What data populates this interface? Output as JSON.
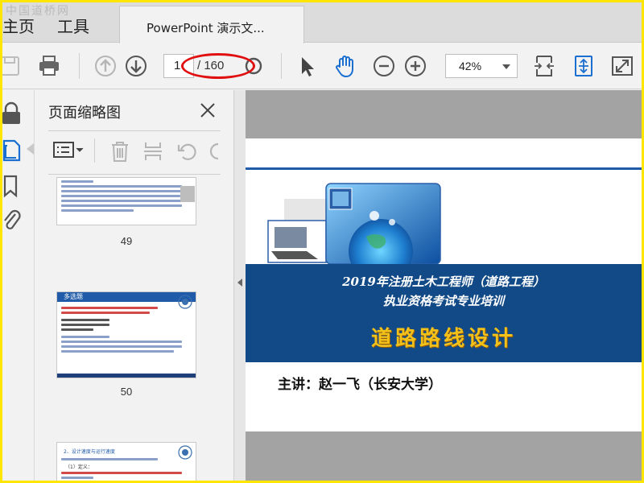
{
  "watermark": "中国道桥网",
  "tabs": {
    "home": "主页",
    "tools": "工具",
    "document": "PowerPoint 演示文..."
  },
  "toolbar": {
    "current_page": "1",
    "page_total": "/ 160",
    "zoom": "42%"
  },
  "panel": {
    "title": "页面缩略图",
    "thumbnails": [
      {
        "label": "49"
      },
      {
        "label": "50"
      }
    ],
    "thumb50_header": "多选题",
    "thumb51_header": "2、设计速度与运行速度",
    "thumb51_subheader": "（1）定义："
  },
  "slide": {
    "title_line1": "2019年注册土木工程师（道路工程）",
    "title_line2": "执业资格考试专业培训",
    "title_main": "道路路线设计",
    "presenter": "主讲：赵一飞（长安大学）"
  },
  "colors": {
    "frame": "#ffe600",
    "slide_band": "#114a87",
    "title_gold": "#f2c21b",
    "annotation_red": "#e01010",
    "icon_blue": "#1a6fd0"
  }
}
